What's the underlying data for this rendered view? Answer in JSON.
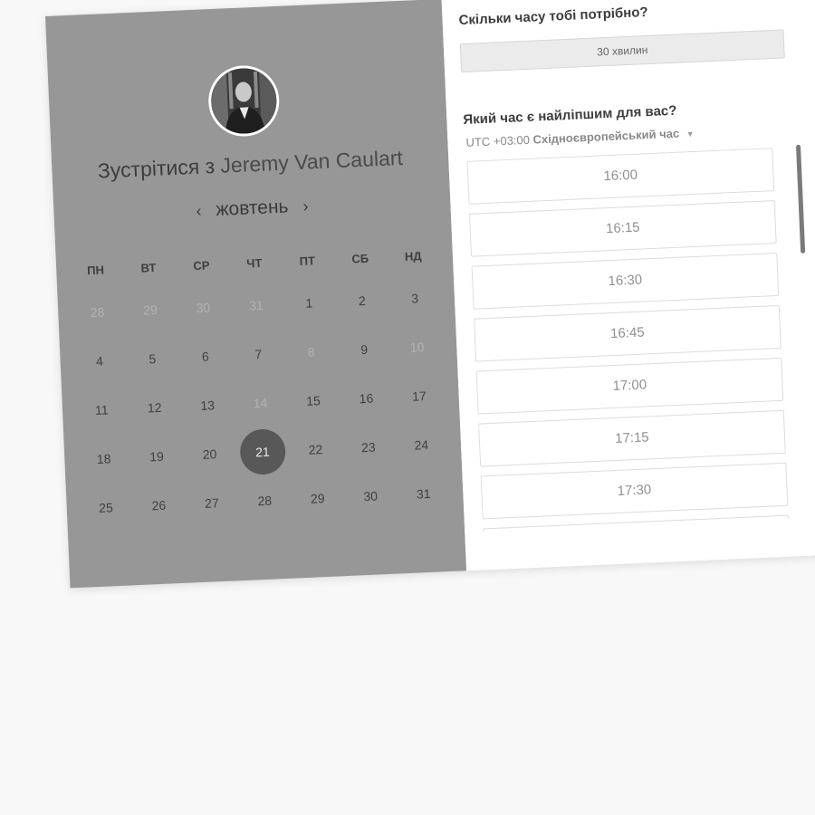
{
  "scheduler": {
    "meet_prefix": "Зустрітися з",
    "host_name": "Jeremy Van Caulart",
    "month": "жовтень",
    "prev_arrow": "‹",
    "next_arrow": "›",
    "weekdays": [
      "ПН",
      "ВТ",
      "СР",
      "ЧТ",
      "ПТ",
      "СБ",
      "НД"
    ],
    "weeks": [
      [
        {
          "d": "28",
          "muted": true
        },
        {
          "d": "29",
          "muted": true
        },
        {
          "d": "30",
          "muted": true
        },
        {
          "d": "31",
          "muted": true
        },
        {
          "d": "1"
        },
        {
          "d": "2"
        },
        {
          "d": "3"
        }
      ],
      [
        {
          "d": "4"
        },
        {
          "d": "5"
        },
        {
          "d": "6"
        },
        {
          "d": "7"
        },
        {
          "d": "8",
          "muted": true
        },
        {
          "d": "9"
        },
        {
          "d": "10",
          "muted": true
        }
      ],
      [
        {
          "d": "11"
        },
        {
          "d": "12"
        },
        {
          "d": "13"
        },
        {
          "d": "14",
          "muted": true
        },
        {
          "d": "15"
        },
        {
          "d": "16"
        },
        {
          "d": "17"
        }
      ],
      [
        {
          "d": "18"
        },
        {
          "d": "19"
        },
        {
          "d": "20"
        },
        {
          "d": "21",
          "selected": true
        },
        {
          "d": "22"
        },
        {
          "d": "23"
        },
        {
          "d": "24"
        }
      ],
      [
        {
          "d": "25"
        },
        {
          "d": "26"
        },
        {
          "d": "27"
        },
        {
          "d": "28"
        },
        {
          "d": "29"
        },
        {
          "d": "30"
        },
        {
          "d": "31"
        }
      ]
    ]
  },
  "booking": {
    "duration_question": "Скільки часу тобі потрібно?",
    "duration_value": "30 хвилин",
    "time_question": "Який час є найліпшим для вас?",
    "tz_offset": "UTC +03:00",
    "tz_name": "Східноєвропейський час",
    "slots": [
      "16:00",
      "16:15",
      "16:30",
      "16:45",
      "17:00",
      "17:15",
      "17:30",
      ""
    ]
  },
  "colors": {
    "left_panel": "#979797",
    "selected_day": "#585858",
    "right_panel": "#ffffff",
    "page_bg": "#f8f8f8"
  }
}
